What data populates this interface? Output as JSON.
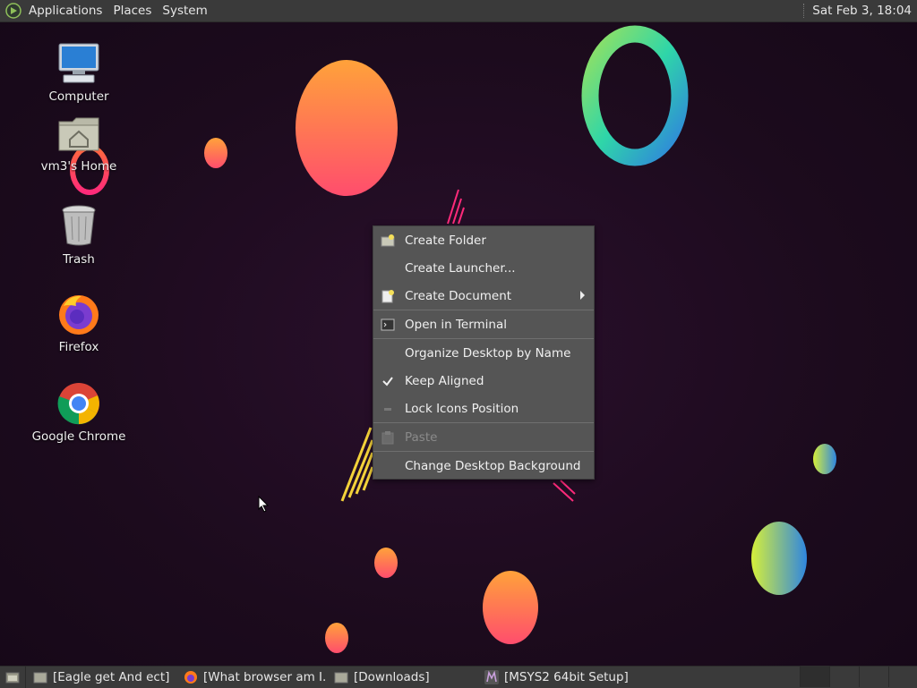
{
  "top_panel": {
    "menus": [
      "Applications",
      "Places",
      "System"
    ],
    "clock": "Sat Feb  3, 18:04"
  },
  "desktop_icons": [
    {
      "label": "Computer",
      "icon": "computer-icon"
    },
    {
      "label": "vm3's Home",
      "icon": "home-folder-icon"
    },
    {
      "label": "Trash",
      "icon": "trash-icon"
    },
    {
      "label": "Firefox",
      "icon": "firefox-icon"
    },
    {
      "label": "Google Chrome",
      "icon": "chrome-icon"
    }
  ],
  "context_menu": {
    "items": [
      {
        "label": "Create Folder",
        "icon": "new-folder-icon",
        "enabled": true
      },
      {
        "label": "Create Launcher...",
        "icon": "",
        "enabled": true
      },
      {
        "label": "Create Document",
        "icon": "new-document-icon",
        "enabled": true,
        "submenu": true
      },
      {
        "label": "Open in Terminal",
        "icon": "terminal-icon",
        "enabled": true
      },
      {
        "label": "Organize Desktop by Name",
        "icon": "",
        "enabled": true
      },
      {
        "label": "Keep Aligned",
        "icon": "checkmark-icon",
        "enabled": true,
        "checked": true
      },
      {
        "label": "Lock Icons Position",
        "icon": "unchecked-box-icon",
        "enabled": true,
        "checked": false
      },
      {
        "label": "Paste",
        "icon": "paste-icon",
        "enabled": false
      },
      {
        "label": "Change Desktop Background",
        "icon": "",
        "enabled": true
      }
    ]
  },
  "taskbar": {
    "tasks": [
      {
        "label": "[Eagle get And ect]",
        "icon": "folder-icon"
      },
      {
        "label": "[What browser am I...",
        "icon": "firefox-icon"
      },
      {
        "label": "[Downloads]",
        "icon": "folder-icon"
      },
      {
        "label": "[MSYS2 64bit Setup]",
        "icon": "msys2-icon"
      }
    ]
  },
  "colors": {
    "panel": "#3a3a3a",
    "menu_bg": "#555555",
    "desktop_bg": "#1c0c1d"
  }
}
